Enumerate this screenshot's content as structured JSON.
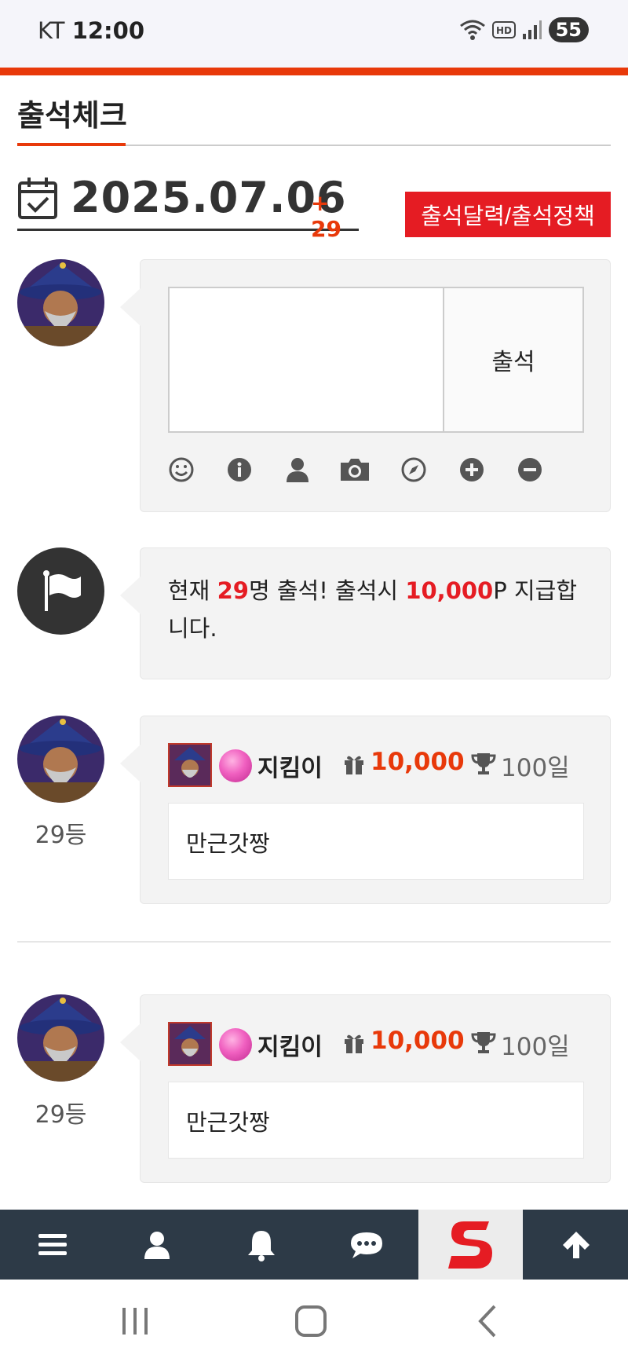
{
  "status_bar": {
    "carrier": "KT",
    "time": "12:00",
    "battery": "55",
    "icons": [
      "wifi-icon",
      "hd-icon",
      "signal-icon",
      "battery-icon"
    ]
  },
  "page": {
    "title": "출석체크",
    "date": "2025.07.06",
    "date_count": "+ 29",
    "calendar_button": "출석달력/출석정책"
  },
  "checkin_form": {
    "textarea_placeholder": "",
    "submit_label": "출석",
    "toolbar_icons": [
      "smile-icon",
      "info-icon",
      "user-icon",
      "camera-icon",
      "compass-icon",
      "plus-circle-icon",
      "minus-circle-icon"
    ]
  },
  "notice": {
    "pre": "현재 ",
    "count": "29",
    "mid": "명 출석! 출석시 ",
    "points": "10,000",
    "post": "P 지급합니다."
  },
  "entries": [
    {
      "rank": "29등",
      "nickname": "지킴이",
      "points": "10,000",
      "days": "100일",
      "message": "만근갓짱"
    },
    {
      "rank": "29등",
      "nickname": "지킴이",
      "points": "10,000",
      "days": "100일",
      "message": "만근갓짱"
    }
  ],
  "bottom_bar": {
    "items": [
      "menu-icon",
      "user-icon",
      "bell-icon",
      "chat-icon",
      "site-logo",
      "arrow-up-icon"
    ]
  },
  "colors": {
    "accent": "#e8390a",
    "button_red": "#e51c23",
    "bottom_bar": "#2d3a47"
  }
}
